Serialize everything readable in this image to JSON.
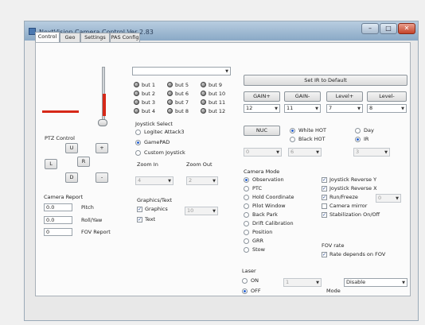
{
  "window": {
    "title": "NextVision Camera Control Ver 2.83",
    "min": "–",
    "max": "□",
    "close": "✕"
  },
  "tabs": [
    "Control",
    "Geo",
    "Settings",
    "PAS Config"
  ],
  "top_dropdown": {
    "value": ""
  },
  "buttons_grid": [
    [
      "but 1",
      "but 5",
      "but 9"
    ],
    [
      "but 2",
      "but 6",
      "but 10"
    ],
    [
      "but 3",
      "but 7",
      "but 11"
    ],
    [
      "but 4",
      "but 8",
      "but 12"
    ]
  ],
  "set_ir_default": "Set IR to Default",
  "gain_buttons": [
    "GAIN+",
    "GAIN-",
    "Level+",
    "Level-"
  ],
  "gain_values": [
    "12",
    "11",
    "7",
    "8"
  ],
  "nuc": "NUC",
  "hot_mode": {
    "options": [
      "White HOT",
      "Black HOT"
    ],
    "selected": 0
  },
  "daylight": {
    "options": [
      "Day",
      "IR"
    ],
    "selected": 1
  },
  "nuc_values": [
    "0",
    "6",
    "3"
  ],
  "ptz": {
    "title": "PTZ Control",
    "up": "U",
    "left": "L",
    "right": "R",
    "down": "D",
    "plus": "+",
    "minus": "-"
  },
  "camera_report": {
    "title": "Camera Report",
    "rows": [
      {
        "value": "0.0",
        "label": "Pitch"
      },
      {
        "value": "0.0",
        "label": "Roll/Yaw"
      },
      {
        "value": "0",
        "label": "FOV Report"
      }
    ]
  },
  "joystick": {
    "title": "Joystick Select",
    "options": [
      "Logitec Attack3",
      "GamePAD",
      "Custom Joystick"
    ],
    "selected": 1
  },
  "zoom": {
    "in_label": "Zoom In",
    "out_label": "Zoom Out",
    "in_value": "4",
    "out_value": "2"
  },
  "graphics": {
    "title": "Graphics/Text",
    "graphics_label": "Graphics",
    "text_label": "Text",
    "value": "10"
  },
  "camera_mode": {
    "title": "Camera Mode",
    "options": [
      "Observation",
      "PTC",
      "Hold Coordinate",
      "Pilot Window",
      "Back Park",
      "Drift Calibration",
      "Position",
      "GRR",
      "Stow"
    ],
    "selected": 0
  },
  "options_checks": [
    {
      "label": "Joystick Reverse Y",
      "checked": true
    },
    {
      "label": "Joystick Reverse X",
      "checked": true
    },
    {
      "label": "Run/Freeze",
      "checked": true
    },
    {
      "label": "Camera mirror",
      "checked": false
    },
    {
      "label": "Stabilization On/Off",
      "checked": true
    }
  ],
  "run_freeze_value": "0",
  "fov_rate": {
    "title": "FOV rate",
    "label": "Rate depends on FOV",
    "checked": true
  },
  "laser": {
    "title": "Laser",
    "options": [
      "ON",
      "OFF"
    ],
    "selected": 1,
    "value": "1",
    "mode_label": "Mode",
    "mode_value": "Disable"
  },
  "colors": {
    "tilt_bar": "#d62818",
    "pan_bar": "#d62818"
  }
}
